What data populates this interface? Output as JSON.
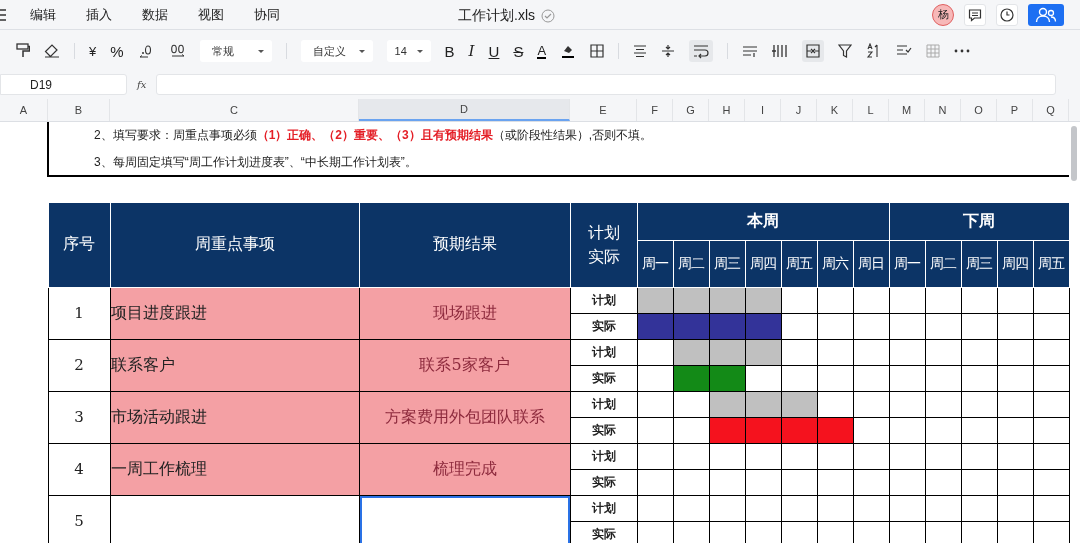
{
  "menu": [
    "编辑",
    "插入",
    "数据",
    "视图",
    "协同"
  ],
  "title": "工作计划.xls",
  "avatar": "杨",
  "toolbar": {
    "currency": "¥",
    "percent": "%",
    "number_format": "常规",
    "font": "自定义",
    "size": "14",
    "bold": "B",
    "italic": "I",
    "underline": "U",
    "strike": "S",
    "font_color": "A"
  },
  "formula_bar": {
    "cell": "D19",
    "fx": "fx"
  },
  "columns": [
    {
      "label": "A",
      "selected": false
    },
    {
      "label": "B",
      "selected": false
    },
    {
      "label": "C",
      "selected": false
    },
    {
      "label": "D",
      "selected": true
    },
    {
      "label": "E",
      "selected": false
    },
    {
      "label": "F",
      "selected": false
    },
    {
      "label": "G",
      "selected": false
    },
    {
      "label": "H",
      "selected": false
    },
    {
      "label": "I",
      "selected": false
    },
    {
      "label": "J",
      "selected": false
    },
    {
      "label": "K",
      "selected": false
    },
    {
      "label": "L",
      "selected": false
    },
    {
      "label": "M",
      "selected": false
    },
    {
      "label": "N",
      "selected": false
    },
    {
      "label": "O",
      "selected": false
    },
    {
      "label": "P",
      "selected": false
    },
    {
      "label": "Q",
      "selected": false
    }
  ],
  "notes": [
    "2、填写要求：周重点事项必须**（1）正确、（2）重要、（3）且有预期结果**（或阶段性结果）,否则不填。",
    "3、每周固定填写“周工作计划进度表”、“中长期工作计划表”。"
  ],
  "table_header": {
    "number": "序号",
    "item": "周重点事项",
    "result": "预期结果",
    "plan_actual": "计划实际",
    "this_week": "本周",
    "next_week": "下周",
    "days": [
      "周一",
      "周二",
      "周三",
      "周四",
      "周五",
      "周六",
      "周日",
      "周一",
      "周二",
      "周三",
      "周四",
      "周五"
    ]
  },
  "rows": [
    {
      "number": "1",
      "item": "项目进度跟进",
      "result": "现场跟进",
      "highlighted": true,
      "selected": false,
      "lines": [
        {
          "label": "计划",
          "color": "#c0c0c0",
          "cells": [
            true,
            true,
            true,
            true,
            false,
            false,
            false,
            false,
            false,
            false,
            false,
            false
          ]
        },
        {
          "label": "实际",
          "color": "#333399",
          "cells": [
            true,
            true,
            true,
            true,
            false,
            false,
            false,
            false,
            false,
            false,
            false,
            false
          ]
        }
      ]
    },
    {
      "number": "2",
      "item": "联系客户",
      "result": "联系5家客户",
      "highlighted": true,
      "selected": false,
      "lines": [
        {
          "label": "计划",
          "color": "#c0c0c0",
          "cells": [
            false,
            true,
            true,
            true,
            false,
            false,
            false,
            false,
            false,
            false,
            false,
            false
          ]
        },
        {
          "label": "实际",
          "color": "#138a17",
          "cells": [
            false,
            true,
            true,
            false,
            false,
            false,
            false,
            false,
            false,
            false,
            false,
            false
          ]
        }
      ]
    },
    {
      "number": "3",
      "item": "市场活动跟进",
      "result": "方案费用外包团队联系",
      "highlighted": true,
      "selected": false,
      "lines": [
        {
          "label": "计划",
          "color": "#c0c0c0",
          "cells": [
            false,
            false,
            true,
            true,
            true,
            false,
            false,
            false,
            false,
            false,
            false,
            false
          ]
        },
        {
          "label": "实际",
          "color": "#f5121e",
          "cells": [
            false,
            false,
            true,
            true,
            true,
            true,
            false,
            false,
            false,
            false,
            false,
            false
          ]
        }
      ]
    },
    {
      "number": "4",
      "item": "一周工作梳理",
      "result": "梳理完成",
      "highlighted": true,
      "selected": false,
      "lines": [
        {
          "label": "计划"
        },
        {
          "label": "实际"
        }
      ]
    },
    {
      "number": "5",
      "highlighted": false,
      "selected": true,
      "lines": [
        {
          "label": "计划"
        },
        {
          "label": "实际"
        }
      ]
    }
  ]
}
